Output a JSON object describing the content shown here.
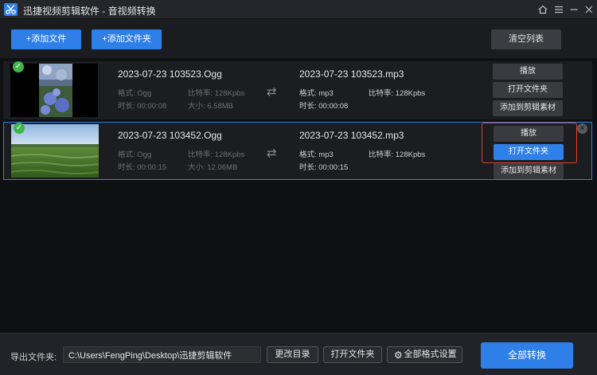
{
  "window": {
    "app_name": "迅捷视频剪辑软件 - 音视频转换",
    "home_icon": "home-icon",
    "menu_icon": "menu-icon",
    "minimize_icon": "minimize-icon",
    "close_icon": "close-icon"
  },
  "toolbar": {
    "add_file": "+添加文件",
    "add_folder": "+添加文件夹",
    "clear_list": "清空列表"
  },
  "files": [
    {
      "source_name": "2023-07-23 103523.Ogg",
      "source_format": "格式: Ogg",
      "source_bitrate": "比特率: 128Kpbs",
      "source_duration": "时长: 00:00:08",
      "source_size": "大小: 6.58MB",
      "output_name": "2023-07-23 103523.mp3",
      "output_format": "格式: mp3",
      "output_bitrate": "比特率: 128Kpbs",
      "output_duration": "时长: 00:00:08",
      "play": "播放",
      "open_folder": "打开文件夹",
      "add_to_material": "添加到剪辑素材"
    },
    {
      "source_name": "2023-07-23 103452.Ogg",
      "source_format": "格式: Ogg",
      "source_bitrate": "比特率: 128Kpbs",
      "source_duration": "时长: 00:00:15",
      "source_size": "大小: 12.06MB",
      "output_name": "2023-07-23 103452.mp3",
      "output_format": "格式: mp3",
      "output_bitrate": "比特率: 128Kpbs",
      "output_duration": "时长: 00:00:15",
      "play": "播放",
      "open_folder": "打开文件夹",
      "add_to_material": "添加到剪辑素材"
    }
  ],
  "footer": {
    "export_label": "导出文件夹:",
    "export_path": "C:\\Users\\FengPing\\Desktop\\迅捷剪辑软件",
    "change_dir": "更改目录",
    "open_folder": "打开文件夹",
    "format_settings": "全部格式设置",
    "convert_all": "全部转换"
  },
  "colors": {
    "accent": "#2f7fe8",
    "highlight": "#e0432e",
    "success": "#3fb54a"
  }
}
